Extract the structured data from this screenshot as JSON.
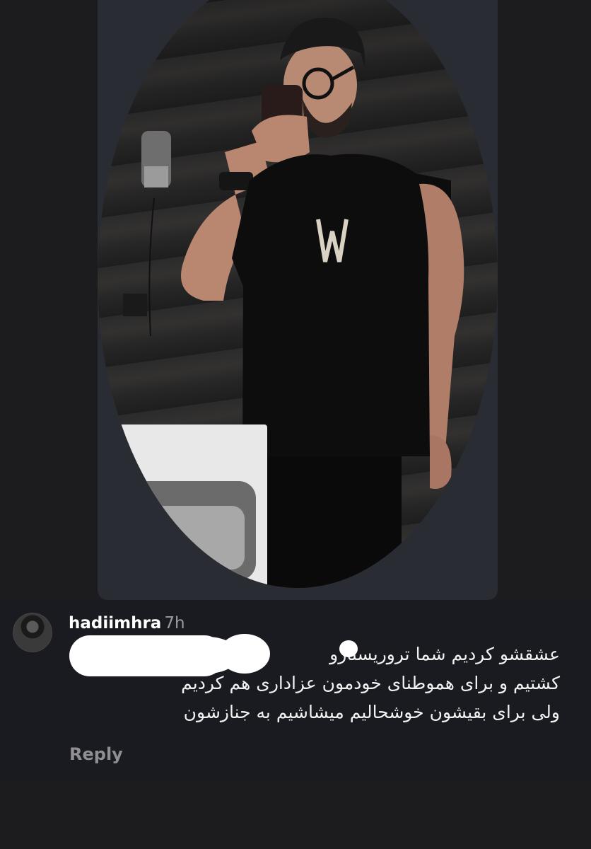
{
  "comment": {
    "username": "hadiimhra",
    "timestamp": "7h",
    "lines": [
      "عشقشو کردیم شما تروریستارو",
      "کشتیم و برای هموطنای خودمون عزاداری هم کردیم",
      "ولی برای بقیشون خوشحالیم میشاشیم به جنازشون"
    ],
    "reply_label": "Reply"
  }
}
